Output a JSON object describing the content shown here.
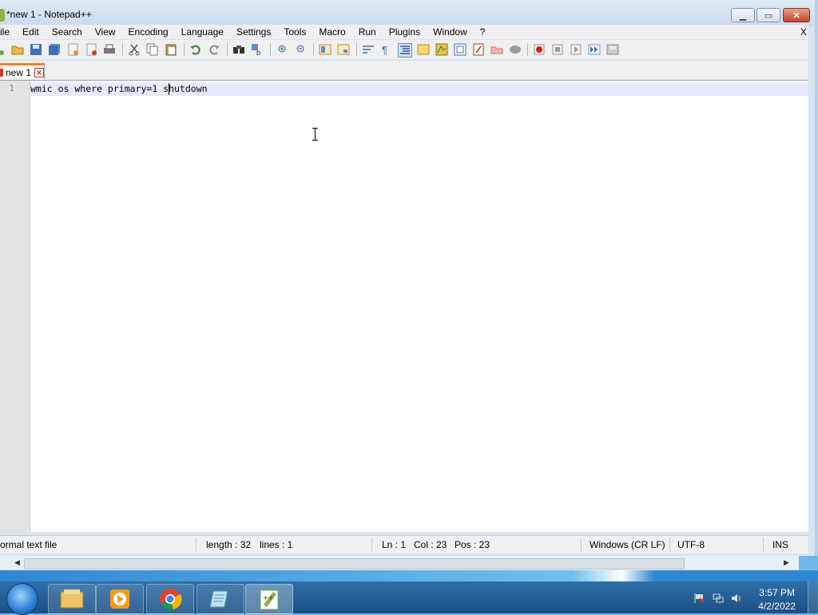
{
  "window": {
    "title": "*new 1 - Notepad++"
  },
  "menubar": {
    "items": [
      "ile",
      "Edit",
      "Search",
      "View",
      "Encoding",
      "Language",
      "Settings",
      "Tools",
      "Macro",
      "Run",
      "Plugins",
      "Window",
      "?"
    ],
    "close_label": "X"
  },
  "tabs": [
    {
      "label": "new 1"
    }
  ],
  "editor": {
    "line_numbers": [
      "1"
    ],
    "lines": [
      "wmic os where primary=1 shutdown"
    ]
  },
  "statusbar": {
    "file_type": "ormal text file",
    "length": "length : 32",
    "lines": "lines : 1",
    "ln": "Ln : 1",
    "col": "Col : 23",
    "pos": "Pos : 23",
    "eol": "Windows (CR LF)",
    "encoding": "UTF-8",
    "mode": "INS"
  },
  "taskbar": {
    "apps": [
      "explorer",
      "media-player",
      "chrome",
      "notepad",
      "notepad-plus-plus"
    ],
    "clock": {
      "time": "3:57 PM",
      "date": "4/2/2022"
    }
  },
  "colors": {
    "tab_accent": "#fa8020",
    "current_line": "#e8e8ff",
    "taskbar": "#1c4f85"
  }
}
